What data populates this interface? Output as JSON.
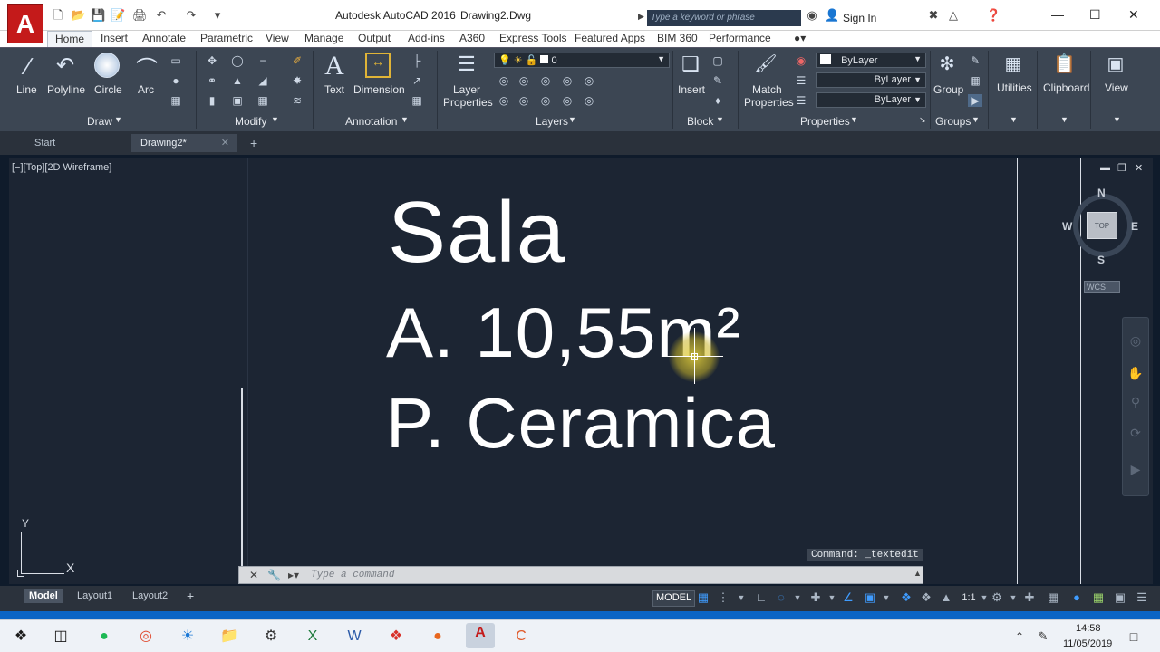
{
  "window": {
    "app_title": "Autodesk AutoCAD 2016",
    "doc_title": "Drawing2.Dwg",
    "logo_letter": "A",
    "search_placeholder": "Type a keyword or phrase",
    "sign_in": "Sign In"
  },
  "ribbon_tabs": [
    "Home",
    "Insert",
    "Annotate",
    "Parametric",
    "View",
    "Manage",
    "Output",
    "Add-ins",
    "A360",
    "Express Tools",
    "Featured Apps",
    "BIM 360",
    "Performance"
  ],
  "draw_tools": [
    "Line",
    "Polyline",
    "Circle",
    "Arc"
  ],
  "annotation_tools": [
    "Text",
    "Dimension"
  ],
  "layer_tool": {
    "line1": "Layer",
    "line2": "Properties"
  },
  "layer_value": "0",
  "block_tool": "Insert",
  "match_tool": {
    "line1": "Match",
    "line2": "Properties"
  },
  "group_tool": "Group",
  "utilities": "Utilities",
  "clipboard": "Clipboard",
  "view_panel": "View",
  "panels": {
    "draw": "Draw",
    "modify": "Modify",
    "annotation": "Annotation",
    "layers": "Layers",
    "block": "Block",
    "properties": "Properties",
    "groups": "Groups"
  },
  "properties": {
    "color": "ByLayer",
    "linetype": "ByLayer",
    "lineweight": "ByLayer"
  },
  "doc_tabs": [
    {
      "label": "Start",
      "active": false
    },
    {
      "label": "Drawing2*",
      "active": true
    }
  ],
  "viewport": {
    "label": "[−][Top][2D Wireframe]"
  },
  "drawing_text": {
    "line1": "Sala",
    "line2": "A. 10,55m²",
    "line3": "P. Ceramica"
  },
  "viewcube": {
    "top": "TOP",
    "n": "N",
    "s": "S",
    "e": "E",
    "w": "W",
    "wcs": "WCS"
  },
  "ucs": {
    "y": "Y",
    "x": "X"
  },
  "command": {
    "history": "Command: _textedit",
    "placeholder": "Type a command"
  },
  "layout_tabs": [
    {
      "label": "Model",
      "active": true
    },
    {
      "label": "Layout1",
      "active": false
    },
    {
      "label": "Layout2",
      "active": false
    }
  ],
  "status": {
    "model": "MODEL",
    "scale": "1:1"
  },
  "taskbar": {
    "time": "14:58",
    "date": "11/05/2019"
  }
}
